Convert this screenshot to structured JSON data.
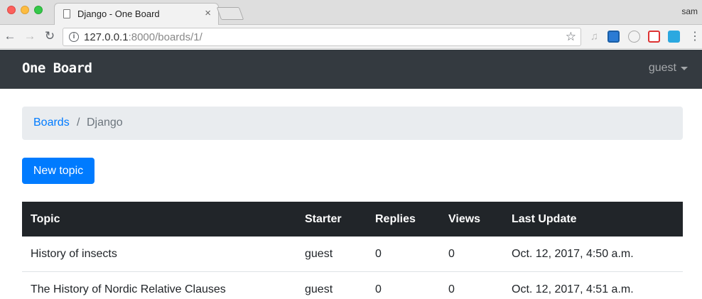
{
  "browser": {
    "tab_title": "Django - One Board",
    "tab_close": "×",
    "profile_name": "sam",
    "url_host": "127.0.0.1",
    "url_rest": ":8000/boards/1/",
    "info_glyph": "i"
  },
  "navbar": {
    "brand": "One Board",
    "user": "guest"
  },
  "breadcrumb": {
    "boards": "Boards",
    "separator": "/",
    "current": "Django"
  },
  "actions": {
    "new_topic": "New topic"
  },
  "table": {
    "headers": [
      "Topic",
      "Starter",
      "Replies",
      "Views",
      "Last Update"
    ],
    "rows": [
      {
        "topic": "History of insects",
        "starter": "guest",
        "replies": "0",
        "views": "0",
        "last_update": "Oct. 12, 2017, 4:50 a.m."
      },
      {
        "topic": "The History of Nordic Relative Clauses",
        "starter": "guest",
        "replies": "0",
        "views": "0",
        "last_update": "Oct. 12, 2017, 4:51 a.m."
      }
    ]
  },
  "colors": {
    "navbar_bg": "#343a40",
    "primary": "#007bff",
    "table_header_bg": "#212529",
    "breadcrumb_bg": "#e9ecef"
  }
}
